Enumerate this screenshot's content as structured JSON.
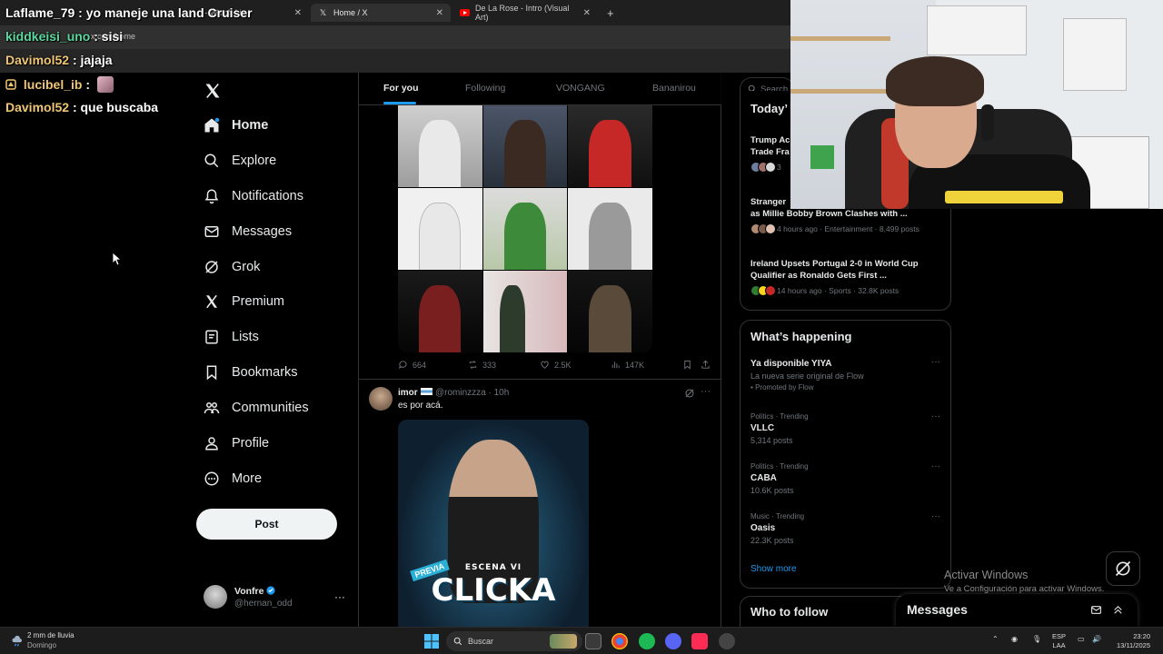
{
  "browser": {
    "tabs": [
      {
        "label": "n - Watch Liv"
      },
      {
        "label": "Home / X"
      },
      {
        "label": "De La Rose - Intro (Visual Art)"
      }
    ],
    "url": "x.com/home"
  },
  "chat": [
    {
      "user": "Laflame_79",
      "message": ": yo maneje una land Cruiser",
      "color": "#ffffff"
    },
    {
      "user": "kiddkeisi_uno",
      "message": ": sisi",
      "color": "#5bd7a0"
    },
    {
      "user": "Davimol52",
      "message": ": jajaja",
      "color": "#f0c674"
    },
    {
      "user": "lucibel_ib",
      "message": ":",
      "color": "#f0c674"
    },
    {
      "user": "Davimol52",
      "message": ": que buscaba",
      "color": "#f0c674"
    }
  ],
  "sidebar": {
    "items": [
      {
        "label": "Home",
        "icon": "home-icon"
      },
      {
        "label": "Explore",
        "icon": "search-icon"
      },
      {
        "label": "Notifications",
        "icon": "bell-icon"
      },
      {
        "label": "Messages",
        "icon": "envelope-icon"
      },
      {
        "label": "Grok",
        "icon": "grok-icon"
      },
      {
        "label": "Premium",
        "icon": "x-icon"
      },
      {
        "label": "Lists",
        "icon": "list-icon"
      },
      {
        "label": "Bookmarks",
        "icon": "bookmark-icon"
      },
      {
        "label": "Communities",
        "icon": "people-icon"
      },
      {
        "label": "Profile",
        "icon": "person-icon"
      },
      {
        "label": "More",
        "icon": "more-circle-icon"
      }
    ],
    "post_label": "Post",
    "account": {
      "name": "Vonfre",
      "handle": "@hernan_odd",
      "more": "···"
    }
  },
  "feed": {
    "tabs": [
      "For you",
      "Following",
      "VONGANG",
      "Bananirou"
    ],
    "tweet1": {
      "replies": "664",
      "reposts": "333",
      "likes": "2.5K",
      "views": "147K"
    },
    "tweet2": {
      "name": "imor",
      "handle": "@rominzzza · 10h",
      "text": "es por acá.",
      "more": "···",
      "poster_tag": "PREVIA",
      "poster_small": "ESCENA VI",
      "poster_big": "CLICKA"
    }
  },
  "right": {
    "search_placeholder": "Search",
    "today_title": "Today’",
    "news": [
      {
        "title": "Trump Ac\nTrade Fra",
        "meta": "3"
      },
      {
        "title": "Stranger\nas Millie Bobby Brown Clashes with ...",
        "meta": "4 hours ago · Entertainment · 8,499 posts"
      },
      {
        "title": "Ireland Upsets Portugal 2-0 in World Cup\nQualifier as Ronaldo Gets First ...",
        "meta": "14 hours ago · Sports · 32.8K posts"
      }
    ],
    "happening_title": "What’s happening",
    "trends": [
      {
        "category": "",
        "name": "Ya disponible YIYA",
        "sub": "La nueva serie original de Flow",
        "promo": "Promoted by Flow"
      },
      {
        "category": "Politics · Trending",
        "name": "VLLC",
        "sub": "5,314 posts"
      },
      {
        "category": "Politics · Trending",
        "name": "CABA",
        "sub": "10.6K posts"
      },
      {
        "category": "Music · Trending",
        "name": "Oasis",
        "sub": "22.3K posts"
      }
    ],
    "show_more": "Show more",
    "who_to_follow": "Who to follow"
  },
  "messages_drawer": {
    "title": "Messages"
  },
  "activate_windows": {
    "line1": "Activar Windows",
    "line2": "Ve a Configuración para activar Windows."
  },
  "taskbar": {
    "weather_line1": "2 mm de lluvia",
    "weather_line2": "Domingo",
    "search": "Buscar",
    "lang_line1": "ESP",
    "lang_line2": "LAA",
    "time": "23:20",
    "date": "13/11/2025"
  },
  "colors": {
    "accent": "#1d9bf0",
    "background": "#000000",
    "text": "#e7e9ea",
    "muted": "#71767b"
  }
}
